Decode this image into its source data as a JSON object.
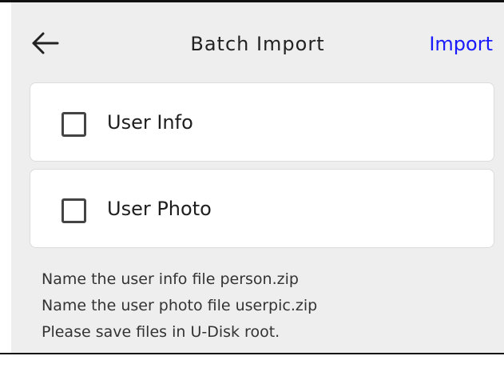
{
  "header": {
    "back_icon": "arrow-left-icon",
    "title": "Batch Import",
    "import_label": "Import"
  },
  "options": [
    {
      "label": "User Info",
      "checked": false
    },
    {
      "label": "User Photo",
      "checked": false
    }
  ],
  "instructions": [
    "Name the user info file person.zip",
    "Name the user photo file userpic.zip",
    "Please save files in U-Disk root."
  ],
  "colors": {
    "background": "#eeeeee",
    "card": "#ffffff",
    "accent": "#1a1aff",
    "text": "#222222"
  }
}
